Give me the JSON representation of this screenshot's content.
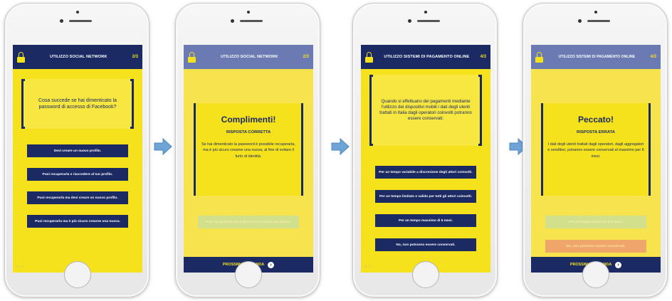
{
  "colors": {
    "navy": "#1b2a63",
    "yellow": "#f5e11c",
    "arrow": "#6fa4d6",
    "correct": "#a9d9a2",
    "wrong": "#e85a5a"
  },
  "screens": [
    {
      "header": {
        "title": "UTILIZZO SOCIAL NETWORK",
        "count": "2/3"
      },
      "question": "Cosa succede se hai dimenticato la password di accesso di Facebook?",
      "options": [
        "Devi creare un nuovo profilo.",
        "Puoi recuperarla e riaccedere al tuo profilo.",
        "Puoi recuperarla ma devi creare un nuovo profilo.",
        "Puoi recuperarla ma è più sicuro crearne una nuova."
      ]
    },
    {
      "header": {
        "title": "UTILIZZO SOCIAL NETWORK",
        "count": "2/3"
      },
      "popup": {
        "title": "Complimenti!",
        "subtitle": "RISPOSTA CORRETTA",
        "body": "Se hai dimenticato la password è possibile recuperarla, ma è più sicuro crearne una nuova, al fine di evitare il furto di identità."
      },
      "faded_option": "Puoi recuperarla ma è più sicuro crearne una nuova.",
      "footer": "PROSSIMA DOMANDA"
    },
    {
      "header": {
        "title": "UTILIZZO SISTEMI DI PAGAMENTO ONLINE",
        "count": "4/3"
      },
      "question": "Quando si effettuano dei pagamenti mediante l'utilizzo dei dispositivi mobili i dati degli utenti trattati in Italia dagli operatori coinvolti potranno essere conservati:",
      "options": [
        "Per un tempo variabile a discrezione degli attori coinvolti.",
        "Per un tempo limitato e valido per tutti gli attori coinvolti.",
        "Per un tempo massimo di 6 mesi.",
        "No, non potranno essere conservati."
      ]
    },
    {
      "header": {
        "title": "UTILIZZO SISTEMI DI PAGAMENTO ONLINE",
        "count": "4/3"
      },
      "popup": {
        "title": "Peccato!",
        "subtitle": "RISPOSTA ERRATA",
        "body": "I dati degli utenti trattati dagli operatori, dagli aggregatori e venditori, potranno essere conservati al massimo per 6 mesi."
      },
      "correct_option": "Per un tempo massimo di 6 mesi.",
      "wrong_option": "No, non potranno essere conservati.",
      "footer": "PROSSIMA DOMANDA"
    }
  ]
}
